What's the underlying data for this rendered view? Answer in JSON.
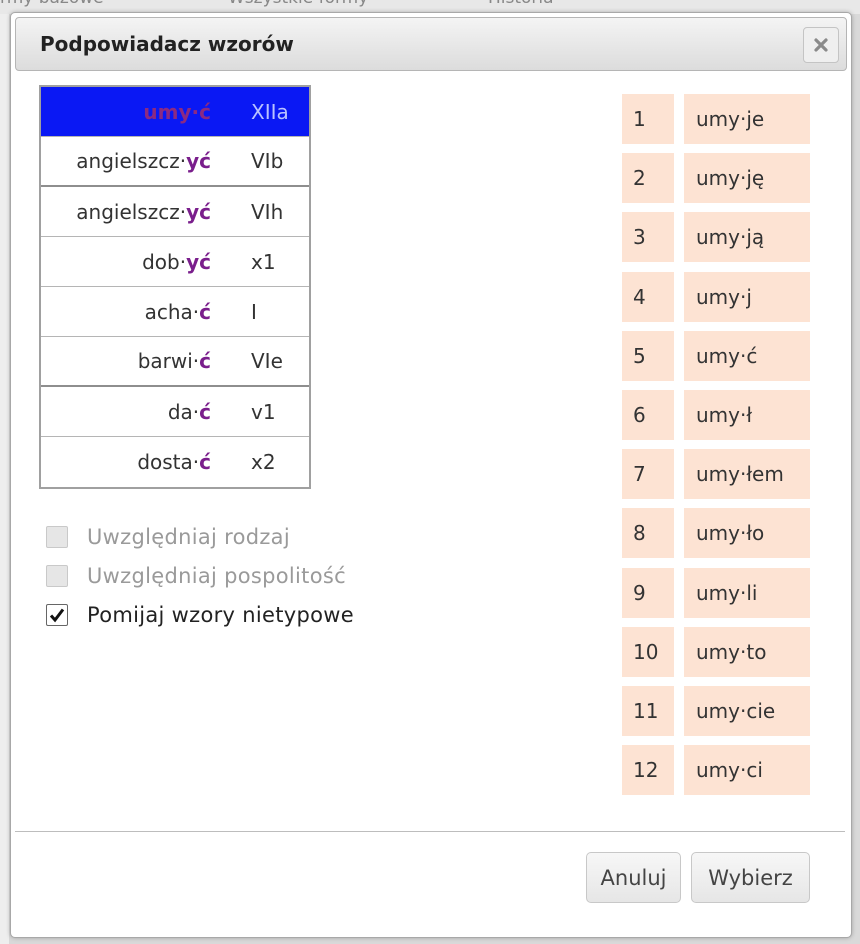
{
  "background_tabs": [
    "rmy bazowe",
    "Wszystkie formy",
    "Historia"
  ],
  "dialog": {
    "title": "Podpowiadacz wzorów",
    "close_icon": "close-icon"
  },
  "patterns": [
    {
      "stem": "umy",
      "sep": "·",
      "ending": "ć",
      "code": "XIIa",
      "selected": true
    },
    {
      "stem": "angielszcz",
      "sep": "·",
      "ending": "yć",
      "code": "VIb"
    },
    {
      "stem": "angielszcz",
      "sep": "·",
      "ending": "yć",
      "code": "VIh"
    },
    {
      "stem": "dob",
      "sep": "·",
      "ending": "yć",
      "code": "x1"
    },
    {
      "stem": "acha",
      "sep": "·",
      "ending": "ć",
      "code": "I"
    },
    {
      "stem": "barwi",
      "sep": "·",
      "ending": "ć",
      "code": "VIe"
    },
    {
      "stem": "da",
      "sep": "·",
      "ending": "ć",
      "code": "v1"
    },
    {
      "stem": "dosta",
      "sep": "·",
      "ending": "ć",
      "code": "x2"
    }
  ],
  "options": {
    "gender": {
      "label": "Uwzględniaj rodzaj",
      "checked": false,
      "enabled": false
    },
    "commonness": {
      "label": "Uwzględniaj pospolitość",
      "checked": false,
      "enabled": false
    },
    "skip_atypical": {
      "label": "Pomijaj wzory nietypowe",
      "checked": true,
      "enabled": true
    }
  },
  "forms": [
    {
      "num": "1",
      "form": "umy·je"
    },
    {
      "num": "2",
      "form": "umy·ję"
    },
    {
      "num": "3",
      "form": "umy·ją"
    },
    {
      "num": "4",
      "form": "umy·j"
    },
    {
      "num": "5",
      "form": "umy·ć"
    },
    {
      "num": "6",
      "form": "umy·ł"
    },
    {
      "num": "7",
      "form": "umy·łem"
    },
    {
      "num": "8",
      "form": "umy·ło"
    },
    {
      "num": "9",
      "form": "umy·li"
    },
    {
      "num": "10",
      "form": "umy·to"
    },
    {
      "num": "11",
      "form": "umy·cie"
    },
    {
      "num": "12",
      "form": "umy·ci"
    }
  ],
  "buttons": {
    "cancel": "Anuluj",
    "choose": "Wybierz"
  },
  "colors": {
    "selected_row": "#0a18f4",
    "ending": "#7a1e8c",
    "form_cell": "#fde3d3"
  }
}
